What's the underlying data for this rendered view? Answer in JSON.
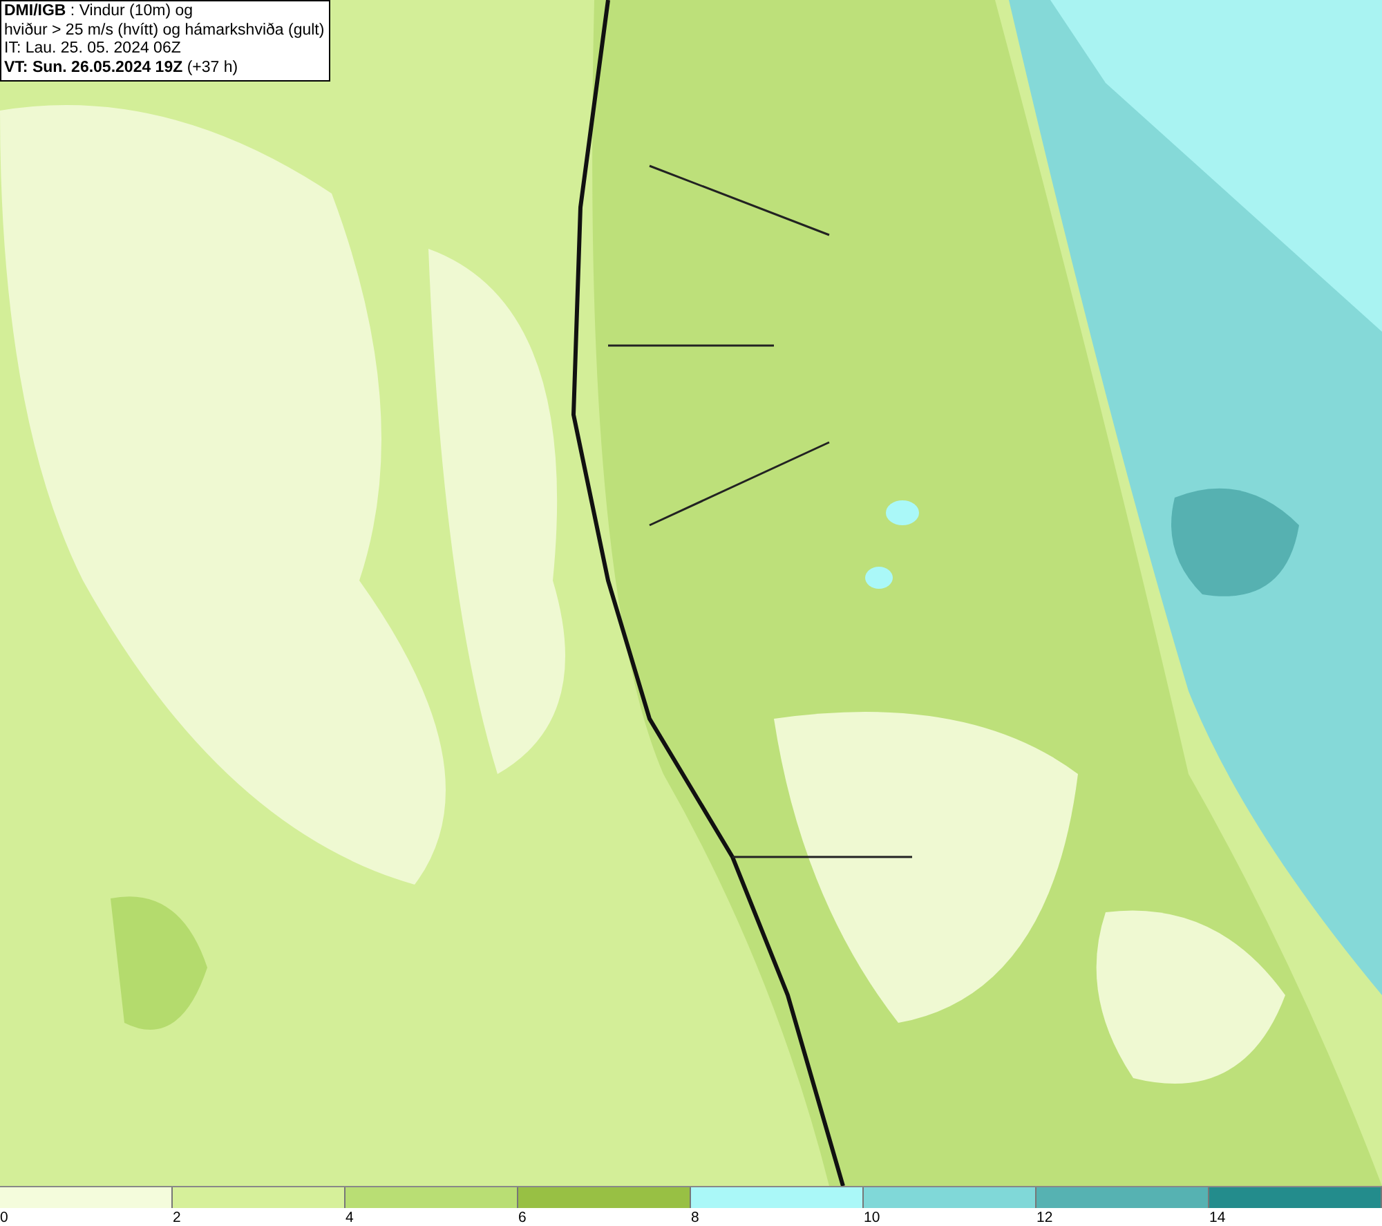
{
  "title_box": {
    "lines": [
      "**DMI/IGB** : Vindur (10m) og",
      "hviður > 25 m/s (hvítt) og hámarkshviða (gult)",
      "IT: Lau. 25. 05. 2024 06Z",
      "**VT: Sun. 26.05.2024 19Z** (+37 h)"
    ]
  },
  "legend": {
    "segments": [
      {
        "color": "#f4fcdc"
      },
      {
        "color": "#d6f09a"
      },
      {
        "color": "#b9de74"
      },
      {
        "color": "#98c044"
      },
      {
        "color": "#aaf8f8"
      },
      {
        "color": "#80d8d8"
      },
      {
        "color": "#56b2b2"
      },
      {
        "color": "#238c8c"
      }
    ],
    "ticks": [
      "0",
      "2",
      "4",
      "6",
      "8",
      "10",
      "12",
      "14"
    ]
  }
}
